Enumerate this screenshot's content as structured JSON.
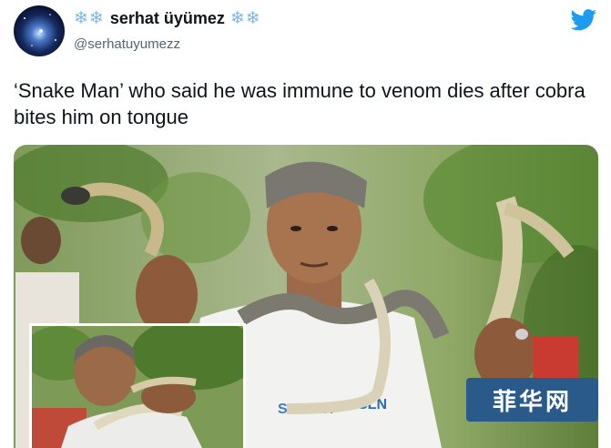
{
  "author": {
    "display_name": "serhat üyümez",
    "decoration_left": "❄❄",
    "decoration_right": "❄❄",
    "handle": "@serhatuyumezz",
    "avatar_icon": "galaxy-avatar-icon"
  },
  "platform_icon": "twitter-bird-icon",
  "colors": {
    "twitter_blue": "#1d9bf0",
    "snowflake": "#7fb6e0",
    "text": "#0f1419",
    "muted": "#536471"
  },
  "tweet": {
    "text": "‘Snake Man’ who said he was immune to venom dies after cobra bites him on tongue"
  },
  "media": {
    "shirt_text_1": "SMARTI",
    "shirt_text_2": "SLN",
    "watermark": "菲华网"
  }
}
